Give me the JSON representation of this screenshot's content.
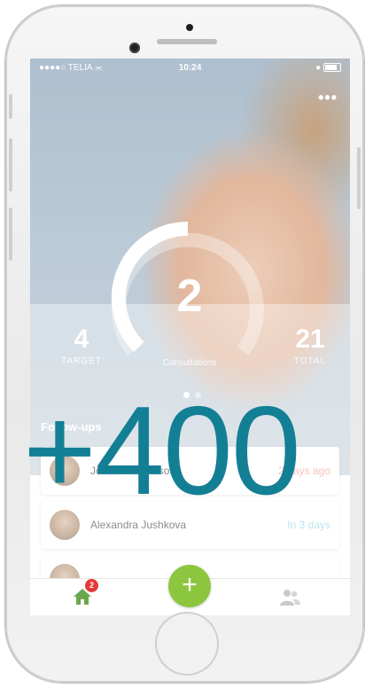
{
  "status_bar": {
    "carrier": "●●●●○ TELIA",
    "time": "10:24"
  },
  "header": {
    "more_label": "•••"
  },
  "dashboard": {
    "current": "2",
    "current_label": "Consultations",
    "target": "4",
    "target_label": "TARGET",
    "total": "21",
    "total_label": "TOTAL",
    "progress_fraction": 0.5,
    "pager_count": 2,
    "pager_active": 0
  },
  "followups": {
    "title": "Follow-ups",
    "items": [
      {
        "name": "Johanna Karlsson",
        "due": "2 days ago",
        "status": "late"
      },
      {
        "name": "Alexandra Jushkova",
        "due": "In 3 days",
        "status": "soon"
      }
    ]
  },
  "tab_bar": {
    "home_badge": "2",
    "add_label": "+"
  },
  "overlay": {
    "text": "+400"
  },
  "colors": {
    "accent_green": "#8cc63f",
    "badge_red": "#e23b3b",
    "overlay_teal": "#137f95",
    "late_pink": "#f09c95",
    "soon_cyan": "#8fd3e2"
  },
  "icons": {
    "home": "home-icon",
    "add": "plus-icon",
    "users": "users-icon",
    "wifi": "wifi-icon",
    "battery": "battery-icon"
  }
}
